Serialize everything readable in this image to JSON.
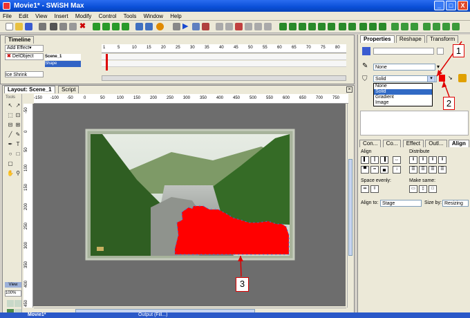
{
  "window": {
    "title": "Movie1* - SWiSH Max",
    "controls": [
      "_",
      "□",
      "X"
    ]
  },
  "menu": [
    "File",
    "Edit",
    "View",
    "Insert",
    "Modify",
    "Control",
    "Tools",
    "Window",
    "Help"
  ],
  "timeline": {
    "tab_label": "Timeline",
    "add_effect": "Add Effect▾",
    "del_object": "DelObject",
    "scene_label": "Scene_1",
    "shape_label": "Shape",
    "effect_label": "Ice Shrink",
    "frame_ticks": [
      "1",
      "5",
      "10",
      "15",
      "20",
      "25",
      "30",
      "35",
      "40",
      "45",
      "50",
      "55",
      "60",
      "65",
      "70",
      "75",
      "80"
    ]
  },
  "layout": {
    "tabs": [
      "Layout: Scene_1",
      "Script"
    ],
    "tools_label": "Tools",
    "view_label": "View",
    "zoom_value": "100%",
    "ruler_h": [
      "-150",
      "-100",
      "-50",
      "0",
      "50",
      "100",
      "150",
      "200",
      "250",
      "300",
      "350",
      "400",
      "450",
      "500",
      "550",
      "600",
      "650",
      "700",
      "750"
    ],
    "ruler_v": [
      "-50",
      "0",
      "50",
      "100",
      "150",
      "200",
      "250",
      "300",
      "350",
      "400",
      "450"
    ]
  },
  "properties": {
    "tabs": [
      "Properties",
      "Reshape",
      "Transform"
    ],
    "line_value": "None",
    "fill_value": "Solid",
    "fill_options": [
      "None",
      "Solid",
      "Gradient",
      "Image"
    ]
  },
  "align_panel": {
    "tabs": [
      "Con...",
      "Co...",
      "Effect",
      "Outl...",
      "Align"
    ],
    "align_label": "Align",
    "distribute_label": "Distribute",
    "space_evenly_label": "Space evenly:",
    "make_same_label": "Make same:",
    "align_to_label": "Align to:",
    "align_to_value": "Stage",
    "size_by_label": "Size by:",
    "size_by_value": "Resizing"
  },
  "callouts": [
    "1",
    "2",
    "3"
  ],
  "taskbar": {
    "item": "Movie1*",
    "item2": "Output (Fill...)"
  },
  "colors": {
    "titlebar": "#0a4fd8",
    "canvas_bg": "#6d6d6d",
    "fill_shape": "#ff0000",
    "callout_border": "#dd0000"
  }
}
